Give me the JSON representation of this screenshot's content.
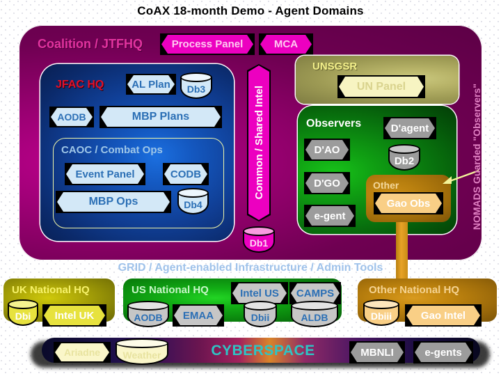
{
  "title": "CoAX 18-month Demo - Agent Domains",
  "coalition": {
    "label": "Coalition / JTFHQ",
    "process_panel": "Process Panel",
    "mca": "MCA"
  },
  "jfac": {
    "label": "JFAC HQ",
    "al_plan": "AL Plan",
    "db3": "Db3",
    "aodb": "AODB",
    "mbp_plans": "MBP Plans",
    "caoc": {
      "label": "CAOC / Combat Ops",
      "event_panel": "Event Panel",
      "codb": "CODB",
      "mbp_ops": "MBP Ops",
      "db4": "Db4"
    }
  },
  "shared_intel": {
    "label": "Common / Shared Intel",
    "db1": "Db1"
  },
  "unsgsr": {
    "label": "UNSGSR",
    "un_panel": "UN Panel"
  },
  "observers": {
    "label": "Observers",
    "dagent": "D'agent",
    "dao": "D'AO",
    "db2": "Db2",
    "dgo": "D'GO",
    "egent": "e-gent",
    "other": {
      "label": "Other",
      "gao_obs": "Gao Obs"
    }
  },
  "nomads": {
    "label": "NOMADS Guarded \"Observers\""
  },
  "grid": {
    "label": "GRID / Agent-enabled Infrastructure / Admin Tools",
    "uk_hq": {
      "label": "UK National HQ",
      "dbi": "Dbi",
      "intel_uk": "Intel UK"
    },
    "us_hq": {
      "label": "US National HQ",
      "intel_us": "Intel US",
      "camps": "CAMPS",
      "aodb": "AODB",
      "emaa": "EMAA",
      "dbii": "Dbii",
      "aldb": "ALDB"
    },
    "other_hq": {
      "label": "Other National HQ",
      "dbiii": "Dbiii",
      "gao_intel": "Gao Intel"
    }
  },
  "cyberspace": {
    "label": "CYBERSPACE",
    "ariadne": "Ariadne",
    "weather": "Weather",
    "mbnli": "MBNLI",
    "egents": "e-gents"
  },
  "colors": {
    "coalition_purple": "#8e0069",
    "chip_pink": "#ec00c0",
    "jfac_blue": "#103f96",
    "unsgsr_olive": "#9d9a54",
    "observers_green": "#0a7d0f",
    "other_orange": "#b9800f",
    "uk_yellow": "#b2ac08",
    "us_green": "#12ad15",
    "cyberspace_teal": "#2ec4c4",
    "arrow_yellow": "#f4f49a"
  }
}
